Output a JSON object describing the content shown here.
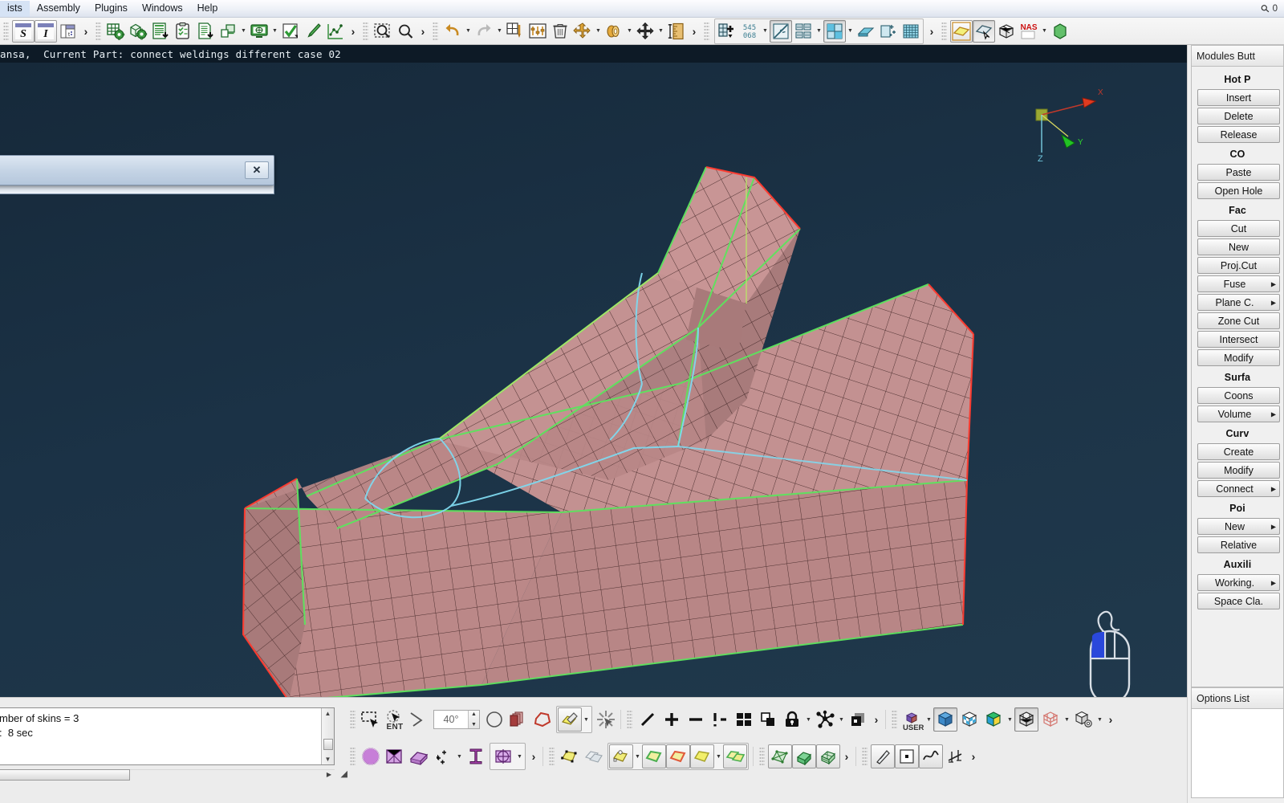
{
  "menubar": {
    "items": [
      "ists",
      "Assembly",
      "Plugins",
      "Windows",
      "Help"
    ],
    "search_icon": "search-icon",
    "search_count": "0"
  },
  "toolbar": {
    "groups": [
      {
        "name": "text-style",
        "buttons": [
          {
            "name": "bold-s-button",
            "label": "S"
          },
          {
            "name": "italic-i-button",
            "label": "I"
          },
          {
            "name": "page-layout-button",
            "label": ""
          }
        ],
        "overflow": "›"
      },
      {
        "name": "model-tools",
        "buttons": [
          {
            "name": "mesh-settings-icon",
            "label": ""
          },
          {
            "name": "geometry-settings-icon",
            "label": ""
          },
          {
            "name": "report-export-icon",
            "label": ""
          },
          {
            "name": "checklist-icon",
            "label": ""
          },
          {
            "name": "document-export-icon",
            "label": ""
          },
          {
            "name": "copy-part-icon",
            "label": ""
          },
          {
            "name": "monitor-session-icon",
            "label": ""
          },
          {
            "name": "checkmark-icon",
            "label": ""
          },
          {
            "name": "paint-brush-icon",
            "label": ""
          },
          {
            "name": "graph-icon",
            "label": ""
          }
        ],
        "overflow": "›"
      },
      {
        "name": "zoom-tools",
        "buttons": [
          {
            "name": "zoom-window-icon",
            "label": ""
          },
          {
            "name": "zoom-icon",
            "label": ""
          }
        ],
        "overflow": "›"
      },
      {
        "name": "edit-tools",
        "buttons": [
          {
            "name": "undo-icon",
            "label": ""
          },
          {
            "name": "redo-icon",
            "label": ""
          },
          {
            "name": "mesh-edit-icon",
            "label": ""
          },
          {
            "name": "parameters-icon",
            "label": ""
          },
          {
            "name": "delete-trash-icon",
            "label": ""
          },
          {
            "name": "move-icon",
            "label": ""
          },
          {
            "name": "project-icon",
            "label": ""
          },
          {
            "name": "translate-icon",
            "label": ""
          },
          {
            "name": "measure-icon",
            "label": ""
          }
        ],
        "overflow": "›"
      },
      {
        "name": "mesh-display",
        "buttons": [
          {
            "name": "add-node-icon",
            "label": ""
          },
          {
            "name": "element-count-icon",
            "label": "545\n068"
          },
          {
            "name": "normals-icon",
            "label": ""
          },
          {
            "name": "list-compare-icon",
            "label": ""
          },
          {
            "name": "quad-split-icon",
            "label": ""
          },
          {
            "name": "shell-thickness-icon",
            "label": ""
          },
          {
            "name": "node-add-icon",
            "label": ""
          },
          {
            "name": "grid-icon",
            "label": ""
          }
        ],
        "overflow": "›"
      },
      {
        "name": "render-modes",
        "buttons": [
          {
            "name": "shaded-surface-icon",
            "label": ""
          },
          {
            "name": "pick-surface-icon",
            "label": ""
          },
          {
            "name": "wireframe-cube-icon",
            "label": ""
          },
          {
            "name": "nastran-deck-icon",
            "label": "NAS"
          }
        ],
        "overflow": ""
      }
    ],
    "element_count_top": "545",
    "element_count_bottom": "068",
    "nas_label": "NAS"
  },
  "statusbar": {
    "text": "ansa,  Current Part: connect weldings different case 02"
  },
  "viewport": {
    "dialog": {
      "name": "floating-dialog",
      "close_label": "✕",
      "title": ""
    },
    "triad": {
      "x_label": "X",
      "y_label": "Y",
      "z_label": "Z"
    },
    "mouse_hint": "mouse-left-button-hint"
  },
  "rightpanel": {
    "tab_label": "Modules Butt",
    "sections": [
      {
        "title": "Hot P",
        "buttons": [
          {
            "label": "Insert",
            "arrow": false,
            "name": "hotpoint-insert-button"
          },
          {
            "label": "Delete",
            "arrow": false,
            "name": "hotpoint-delete-button"
          },
          {
            "label": "Release",
            "arrow": false,
            "name": "hotpoint-release-button"
          }
        ]
      },
      {
        "title": "CO",
        "buttons": [
          {
            "label": "Paste",
            "arrow": false,
            "name": "cons-paste-button"
          },
          {
            "label": "Open Hole",
            "arrow": false,
            "name": "cons-open-hole-button"
          }
        ]
      },
      {
        "title": "Fac",
        "buttons": [
          {
            "label": "Cut",
            "arrow": false,
            "name": "faces-cut-button"
          },
          {
            "label": "New",
            "arrow": false,
            "name": "faces-new-button"
          },
          {
            "label": "Proj.Cut",
            "arrow": false,
            "name": "faces-proj-cut-button"
          },
          {
            "label": "Fuse",
            "arrow": true,
            "name": "faces-fuse-button"
          },
          {
            "label": "Plane C.",
            "arrow": true,
            "name": "faces-plane-cut-button"
          },
          {
            "label": "Zone Cut",
            "arrow": false,
            "name": "faces-zone-cut-button"
          },
          {
            "label": "Intersect",
            "arrow": false,
            "name": "faces-intersect-button"
          },
          {
            "label": "Modify",
            "arrow": false,
            "name": "faces-modify-button"
          }
        ]
      },
      {
        "title": "Surfa",
        "buttons": [
          {
            "label": "Coons",
            "arrow": false,
            "name": "surfaces-coons-button"
          },
          {
            "label": "Volume",
            "arrow": true,
            "name": "surfaces-volume-button"
          }
        ]
      },
      {
        "title": "Curv",
        "buttons": [
          {
            "label": "Create",
            "arrow": false,
            "name": "curves-create-button"
          },
          {
            "label": "Modify",
            "arrow": false,
            "name": "curves-modify-button"
          },
          {
            "label": "Connect",
            "arrow": true,
            "name": "curves-connect-button"
          }
        ]
      },
      {
        "title": "Poi",
        "buttons": [
          {
            "label": "New",
            "arrow": true,
            "name": "points-new-button"
          },
          {
            "label": "Relative",
            "arrow": false,
            "name": "points-relative-button"
          }
        ]
      },
      {
        "title": "Auxili",
        "buttons": [
          {
            "label": "Working.",
            "arrow": true,
            "name": "aux-working-plane-button"
          },
          {
            "label": "Space Cla.",
            "arrow": false,
            "name": "aux-space-claim-button"
          }
        ]
      }
    ],
    "options_list_label": "Options List"
  },
  "console": {
    "lines": [
      "mber of skins = 3",
      ":  8 sec"
    ],
    "scroll_up": "▲",
    "scroll_down": "▼",
    "hscroll_right": "▶"
  },
  "bottombar": {
    "row1": {
      "selection": [
        {
          "name": "rectangle-select-icon"
        },
        {
          "name": "entity-select-icon",
          "label": "ENT"
        },
        {
          "name": "angle-pick-icon"
        }
      ],
      "angle_value": "40°",
      "shapes": [
        {
          "name": "circle-select-icon"
        },
        {
          "name": "box-select-icon"
        },
        {
          "name": "polygon-select-icon"
        },
        {
          "name": "paint-select-icon"
        },
        {
          "name": "deselect-icon"
        }
      ],
      "draw": [
        {
          "name": "line-icon"
        },
        {
          "name": "plus-icon"
        },
        {
          "name": "minus-icon"
        },
        {
          "name": "invert-icon",
          "label": "!-"
        },
        {
          "name": "grid-four-icon"
        },
        {
          "name": "group-icon"
        },
        {
          "name": "lock-icon"
        },
        {
          "name": "nodes-icon"
        },
        {
          "name": "layers-icon"
        }
      ],
      "view": [
        {
          "name": "user-view-icon",
          "label": "USER"
        },
        {
          "name": "shaded-cube-icon"
        },
        {
          "name": "checker-cube-icon"
        },
        {
          "name": "colored-cube-icon"
        },
        {
          "name": "wireframe-shaded-cube-icon"
        },
        {
          "name": "red-wireframe-cube-icon"
        },
        {
          "name": "cube-settings-icon"
        }
      ]
    },
    "row2": {
      "entities": [
        {
          "name": "point-entity-icon"
        },
        {
          "name": "ghost-faces-icon"
        },
        {
          "name": "hotpoint-face-icon"
        },
        {
          "name": "green-face-icon"
        },
        {
          "name": "red-face-icon"
        },
        {
          "name": "yellow-face-icon"
        },
        {
          "name": "double-face-icon"
        }
      ],
      "sphere": [
        {
          "name": "sphere-icon"
        },
        {
          "name": "box-geometry-icon"
        },
        {
          "name": "prism-icon"
        },
        {
          "name": "move-points-icon"
        },
        {
          "name": "beam-section-icon"
        },
        {
          "name": "section-cut-icon"
        }
      ],
      "mesh": [
        {
          "name": "mesh-wireframe-icon"
        },
        {
          "name": "solid-mesh-icon"
        },
        {
          "name": "volume-mesh-icon"
        }
      ],
      "tools": [
        {
          "name": "pencil-measure-icon"
        },
        {
          "name": "point-square-icon"
        },
        {
          "name": "curve-icon"
        },
        {
          "name": "dimension-icon"
        }
      ]
    },
    "overflow_chevron": "›"
  }
}
